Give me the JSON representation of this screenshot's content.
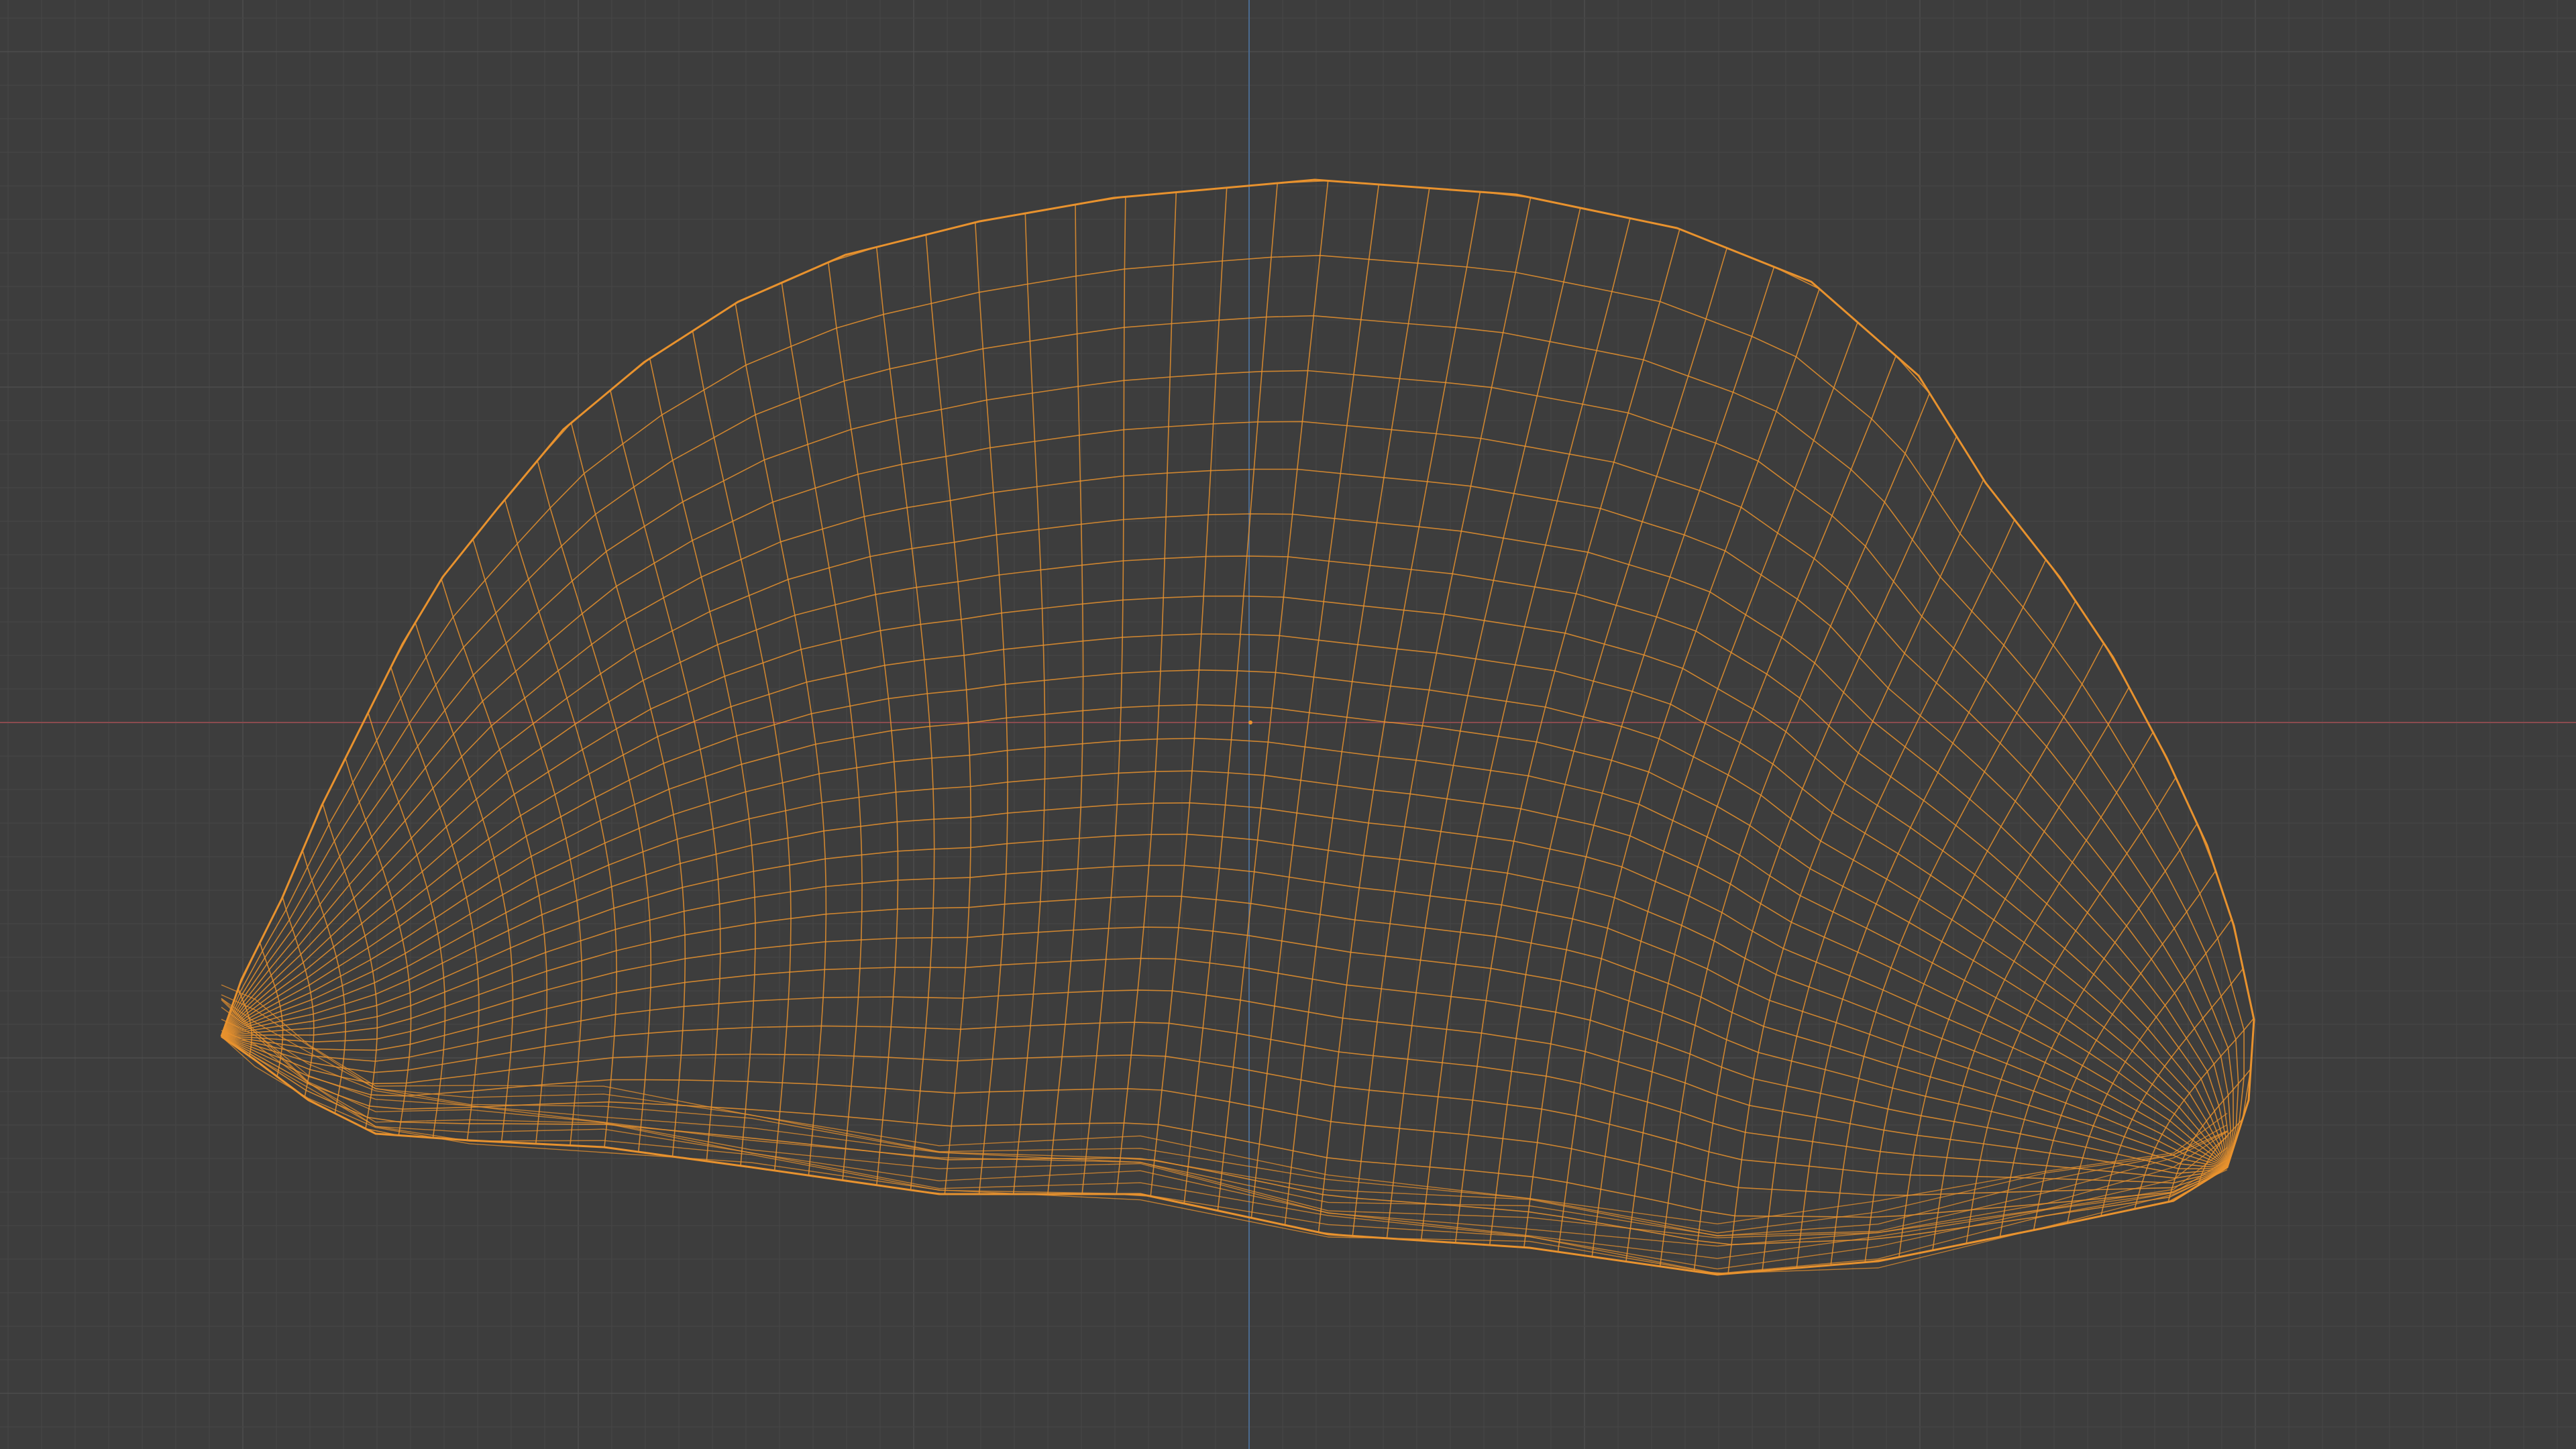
{
  "viewport": {
    "background_color": "#3d3d3d",
    "grid": {
      "visible": true,
      "minor_color": "#454545",
      "major_color": "#4d4d4d"
    },
    "axes": {
      "x_axis_color": "#8a4b4f",
      "y_axis_color": "#4b6a8f"
    }
  },
  "object": {
    "type": "mesh",
    "display_mode": "wireframe",
    "shape": "half-dome",
    "selected": true,
    "wire_color": "#e8922e"
  },
  "origin_marker": {
    "visible": true,
    "color": "#e8922e"
  }
}
